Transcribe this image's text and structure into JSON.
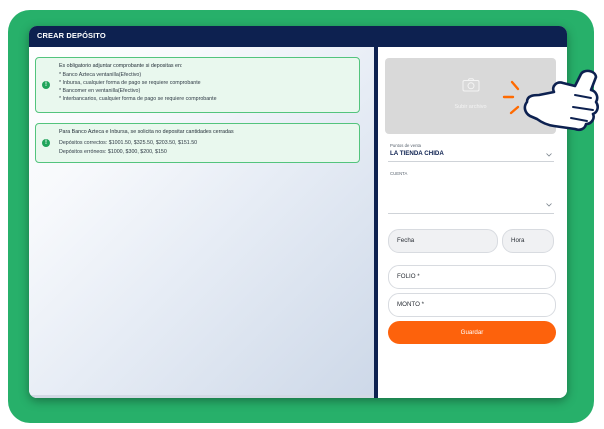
{
  "window": {
    "title": "CREAR DEPÓSITO"
  },
  "alerts": [
    {
      "lines": [
        "Es obligatorio adjuntar comprobante si depositas en:",
        "* Banco Azteca ventanilla(Efectivo)",
        "* Inbursa, cualquier forma de pago se requiere comprobante",
        "* Bancomer en ventanilla(Efectivo)",
        "* Interbancarios, cualquier forma de pago se requiere comprobante"
      ]
    },
    {
      "lines": [
        "Para Banco Azteca e Inbursa, se solicita no depositar cantidades cerradas",
        "Depósitos correctos: $1001.50, $325.50, $203.50, $151.50",
        "Depósitos erróneos: $1000, $300, $200, $150"
      ]
    }
  ],
  "upload": {
    "label": "Subir archivo",
    "icon": "camera-icon"
  },
  "form": {
    "punto_venta": {
      "label": "Puntos de venta",
      "value": "LA TIENDA CHIDA"
    },
    "cuenta": {
      "label": "CUENTA",
      "value": ""
    },
    "fecha": {
      "placeholder": "Fecha"
    },
    "hora": {
      "placeholder": "Hora"
    },
    "folio": {
      "placeholder": "FOLIO *"
    },
    "monto": {
      "placeholder": "MONTO *"
    },
    "save_label": "Guardar"
  },
  "colors": {
    "frame": "#27b06a",
    "titlebar": "#0d2150",
    "alert_bg": "#e9f8ee",
    "alert_border": "#53c47d",
    "accent": "#fd620c",
    "hand_spark": "#ff6a00"
  }
}
